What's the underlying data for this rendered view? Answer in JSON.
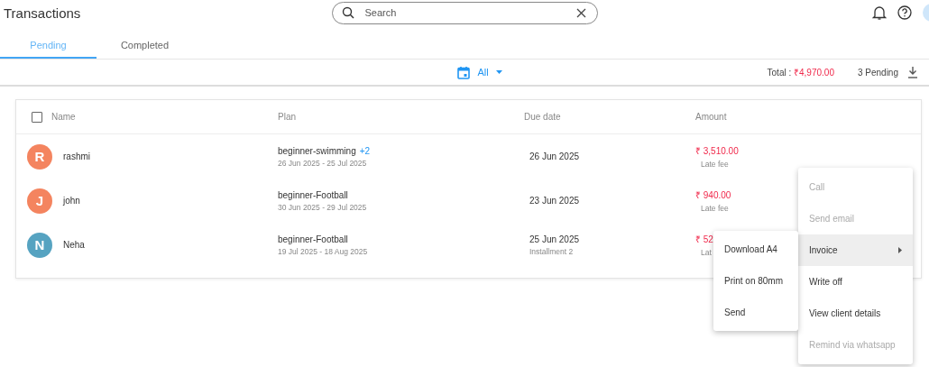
{
  "header": {
    "title": "Transactions",
    "search": {
      "placeholder": "Search"
    }
  },
  "tabs": [
    {
      "label": "Pending",
      "selected": true
    },
    {
      "label": "Completed",
      "selected": false
    }
  ],
  "toolbar": {
    "date_filter": "All",
    "total_label": "Total :",
    "total_value": "₹4,970.00",
    "pending_count": "3 Pending"
  },
  "table": {
    "select_all": {
      "checked": false
    },
    "columns": [
      "Name",
      "Plan",
      "Due date",
      "Amount"
    ],
    "rows": [
      {
        "initial": "R",
        "color": "#f4845f",
        "name": "rashmi",
        "plan": "beginner-swimming",
        "plan_extra": "+2",
        "period": "26 Jun 2025 - 25 Jul 2025",
        "due_date": "26 Jun 2025",
        "amount": "₹ 3,510.00",
        "amount_note": "Late fee"
      },
      {
        "initial": "J",
        "color": "#f4845f",
        "name": "john",
        "plan": "beginner-Football",
        "period": "30 Jun 2025 - 29 Jul 2025",
        "due_date": "23 Jun 2025",
        "amount": "₹ 940.00",
        "amount_note": "Late fee"
      },
      {
        "initial": "N",
        "color": "#56a3c1",
        "name": "Neha",
        "plan": "beginner-Football",
        "period": "19 Jul 2025 - 18 Aug 2025",
        "due_date": "25 Jun 2025",
        "due_note": "Installment 2",
        "amount": "₹ 52",
        "amount_note": "Lat"
      }
    ]
  },
  "row_menu": {
    "items": [
      {
        "label": "Call",
        "kind": "action",
        "disabled": true,
        "highlighted": false
      },
      {
        "label": "Send email",
        "kind": "action",
        "disabled": true,
        "highlighted": false
      },
      {
        "label": "Invoice",
        "kind": "submenu",
        "disabled": false,
        "highlighted": true
      },
      {
        "label": "Write off",
        "kind": "action",
        "disabled": false,
        "highlighted": false
      },
      {
        "label": "View client details",
        "kind": "action",
        "disabled": false,
        "highlighted": false
      },
      {
        "label": "Remind via whatsapp",
        "kind": "action",
        "disabled": true,
        "highlighted": false
      }
    ]
  },
  "submenu": {
    "items": [
      {
        "label": "Download A4"
      },
      {
        "label": "Print on 80mm"
      },
      {
        "label": "Send"
      }
    ]
  }
}
